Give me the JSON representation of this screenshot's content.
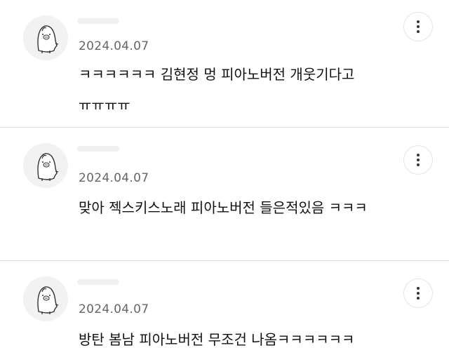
{
  "comments": [
    {
      "date": "2024.04.07",
      "text": "ㅋㅋㅋㅋㅋㅋ 김현정 멍 피아노버전 개웃기다고 ㅠㅠㅠㅠ",
      "avatar_icon": "pig-character-icon",
      "more_icon": "more-vertical-icon"
    },
    {
      "date": "2024.04.07",
      "text": "맞아 젝스키스노래 피아노버전 들은적있음 ㅋㅋㅋ",
      "avatar_icon": "pig-character-icon",
      "more_icon": "more-vertical-icon"
    },
    {
      "date": "2024.04.07",
      "text": "방탄 봄남 피아노버전 무조건 나옴ㅋㅋㅋㅋㅋㅋ",
      "avatar_icon": "pig-character-icon",
      "more_icon": "more-vertical-icon"
    }
  ]
}
